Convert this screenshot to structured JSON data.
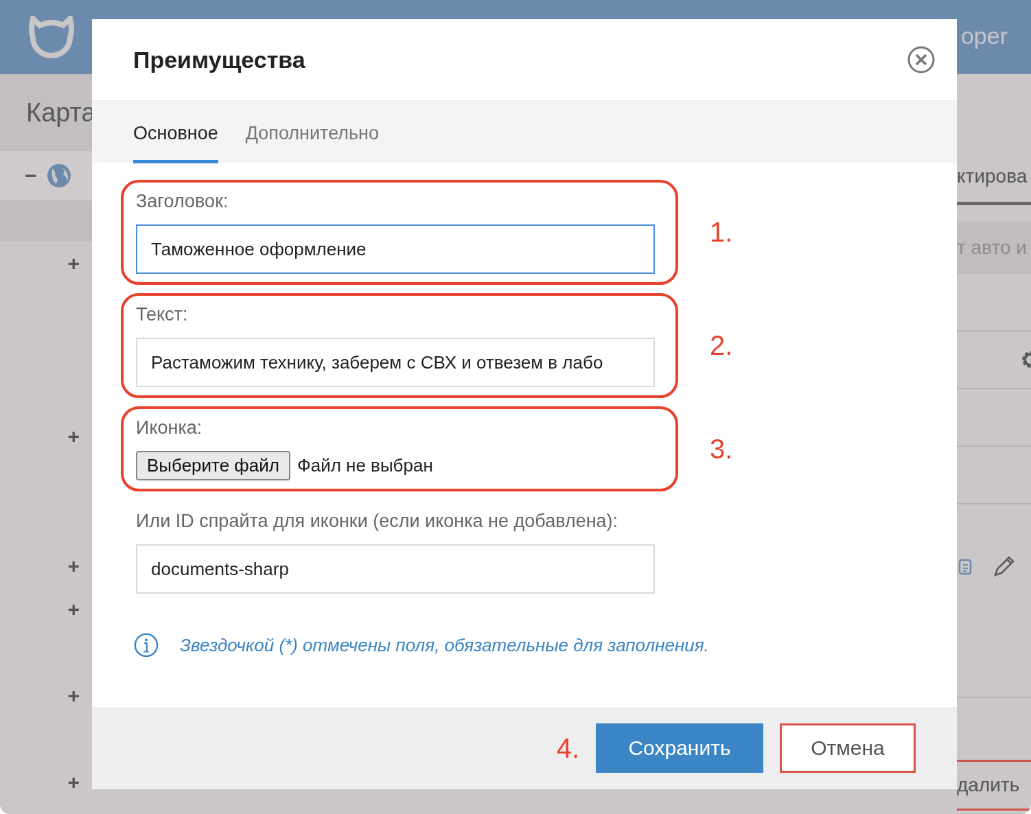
{
  "background": {
    "app_title": "oper",
    "page_title": "Карта",
    "root_expander": "−",
    "tree_expanders": [
      "+",
      "+",
      "+",
      "+",
      "+",
      "+"
    ],
    "right_fragments": [
      "ктирова",
      "т авто и",
      "далить"
    ]
  },
  "dialog": {
    "title": "Преимущества",
    "tabs": [
      {
        "label": "Основное",
        "selected": true
      },
      {
        "label": "Дополнительно",
        "selected": false
      }
    ],
    "fields": [
      {
        "kind": "text",
        "label": "Заголовок:",
        "value": "Таможенное оформление",
        "focused": true,
        "annotation": "1."
      },
      {
        "kind": "text",
        "label": "Текст:",
        "value": "Растаможим технику, заберем с СВХ и отвезем в лабо",
        "focused": false,
        "annotation": "2."
      },
      {
        "kind": "file",
        "label": "Иконка:",
        "button": "Выберите файл",
        "status": "Файл не выбран",
        "annotation": "3."
      },
      {
        "kind": "text",
        "label": "Или ID спрайта для иконки (если иконка не добавлена):",
        "value": "documents-sharp",
        "focused": false
      }
    ],
    "note": "Звездочкой (*) отмечены поля, обязательные для заполнения.",
    "footer": {
      "annotation": "4.",
      "buttons": [
        {
          "label": "Сохранить",
          "kind": "primary",
          "annotated": false
        },
        {
          "label": "Отмена",
          "kind": "secondary",
          "annotated": true
        }
      ]
    }
  }
}
